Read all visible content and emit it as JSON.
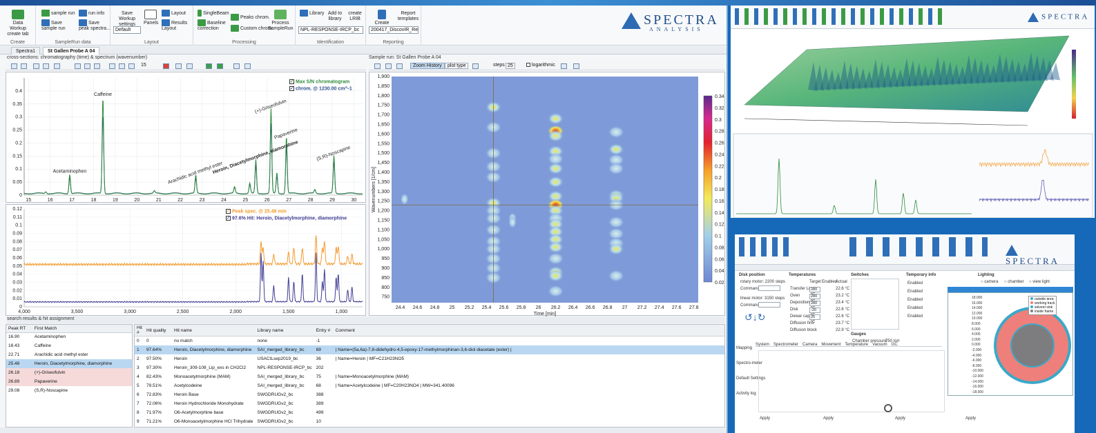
{
  "ribbon": {
    "groups": [
      "Create",
      "SampleRun data",
      "Layout",
      "Processing",
      "Identification",
      "Reporting"
    ],
    "data_workup": "Data Workup create tab",
    "sample_run": "sample run",
    "run_info": "run info",
    "save_sample_run": "Save sample run",
    "save_peak_spectra": "Save peak spectra...",
    "save_workup_settings": "Save Workup settings",
    "workup_default": "Default",
    "panels": "Panels",
    "layout": "Layout",
    "results_layout": "Results Layout",
    "singlebeam": "SingleBeam",
    "baseline_correction": "Baseline correction",
    "peaks_chrom": "Peaks chrom.",
    "custom_chrom": "Custom chrom.",
    "process_samplerun": "Process SampleRun",
    "library": "Library",
    "add_to_library": "Add to library",
    "create_lib": "create LRIB",
    "library_value": "NPL-RESPONSE-IRCP_bc",
    "create_report": "Create Report",
    "report_templates": "Report templates",
    "report_value": "200417_DiscovIR_Repo"
  },
  "logo": {
    "name": "SPECTRA",
    "sub": "ANALYSIS"
  },
  "tabs": [
    "Spectra1",
    "St Gallen Probe A 04"
  ],
  "left_header": "cross-sections: chromatography (time) & spectrum (wavenumber)",
  "right_header": "Sample run: St Gallen Probe A 04",
  "chrom_toolbar": {
    "step": "15"
  },
  "heat_toolbar": {
    "zoom_history": "Zoom History",
    "plot_type": "plot type",
    "steps_label": "steps",
    "steps": "25",
    "logarithmic": "logarithmic"
  },
  "chrom_legend": {
    "s1": "Max S/N chromatogram",
    "s2": "chrom. @ 1230.00 cm^-1"
  },
  "spec_legend": {
    "s1": "Peak spec. @ 25.48 min",
    "s2": "97.6% Hit: Heroin,  Diacetylmorphine, diamorphine"
  },
  "chrom_peaks": [
    {
      "label": "Acetaminophen",
      "x": 16.9,
      "y": 0.075
    },
    {
      "label": "Caffeine",
      "x": 18.43,
      "y": 0.37
    },
    {
      "label": "Arachidic acid methyl ester",
      "x": 22.71,
      "y": 0.07
    },
    {
      "label": "Heroin,  Diacetylmorphine, diamorphine",
      "x": 25.48,
      "y": 0.13
    },
    {
      "label": "(+)-Griseofulvin",
      "x": 26.18,
      "y": 0.325
    },
    {
      "label": "Papaverine",
      "x": 26.89,
      "y": 0.22
    },
    {
      "label": "(S,R)-Noscapine",
      "x": 29.08,
      "y": 0.145
    }
  ],
  "chart_data": [
    {
      "type": "line",
      "title": "",
      "xlabel": "",
      "ylabel": "",
      "xlim": [
        14.8,
        30.4
      ],
      "ylim": [
        0,
        0.45
      ],
      "xticks": [
        "15",
        "16",
        "17",
        "18",
        "19",
        "20",
        "21",
        "22",
        "23",
        "24",
        "25",
        "26",
        "27",
        "28",
        "29",
        "30"
      ],
      "yticks": [
        "0",
        "0.05",
        "0.1",
        "0.15",
        "0.2",
        "0.25",
        "0.3",
        "0.35",
        "0.4"
      ],
      "series": [
        {
          "name": "Max S/N chromatogram",
          "color": "#2f8a3c"
        },
        {
          "name": "chrom. @ 1230.00 cm^-1",
          "color": "#2f4f8f"
        }
      ]
    },
    {
      "type": "line",
      "xlim": [
        4000,
        800
      ],
      "ylim": [
        0,
        0.12
      ],
      "xticks": [
        "4,000",
        "3,500",
        "3,000",
        "2,500",
        "2,000",
        "1,500",
        "1,000"
      ],
      "yticks": [
        "0",
        "0.01",
        "0.02",
        "0.03",
        "0.04",
        "0.05",
        "0.06",
        "0.07",
        "0.08",
        "0.09",
        "0.1",
        "0.11",
        "0.12"
      ],
      "series": [
        {
          "name": "Peak spec. @ 25.48 min",
          "color": "#f39a2c"
        },
        {
          "name": "97.6% Hit: Heroin,  Diacetylmorphine, diamorphine",
          "color": "#3d3b93"
        }
      ]
    },
    {
      "type": "heatmap",
      "xlabel": "Time [min]",
      "ylabel": "Wavenumbers [1/cm]",
      "xlim": [
        24.3,
        27.85
      ],
      "ylim": [
        720,
        1900
      ],
      "xticks": [
        "24.4",
        "24.6",
        "24.8",
        "25",
        "25.2",
        "25.4",
        "25.6",
        "25.8",
        "26",
        "26.2",
        "26.4",
        "26.6",
        "26.8",
        "27",
        "27.2",
        "27.4",
        "27.6",
        "27.8"
      ],
      "yticks": [
        "750",
        "800",
        "850",
        "900",
        "950",
        "1,000",
        "1,050",
        "1,100",
        "1,150",
        "1,200",
        "1,250",
        "1,300",
        "1,350",
        "1,400",
        "1,450",
        "1,500",
        "1,550",
        "1,600",
        "1,650",
        "1,700",
        "1,750",
        "1,800",
        "1,850",
        "1,900"
      ],
      "colorbar": [
        "0.34",
        "0.32",
        "0.3",
        "0.28",
        "0.26",
        "0.24",
        "0.22",
        "0.2",
        "0.18",
        "0.16",
        "0.14",
        "0.12",
        "0.1",
        "0.08",
        "0.06",
        "0.04",
        "0.02"
      ]
    }
  ],
  "results_header": "search results & hit assignment",
  "peaks_table": {
    "headers": [
      "Peak RT",
      "First Match"
    ],
    "rows": [
      [
        "16.90",
        "Acetaminophen"
      ],
      [
        "18.43",
        "Caffeine"
      ],
      [
        "22.71",
        "Arachidic acid methyl ester"
      ],
      [
        "25.48",
        "Heroin,  Diacetylmorphine, diamorphine"
      ],
      [
        "26.18",
        "(+)-Griseofulvin"
      ],
      [
        "26.89",
        "Papaverine"
      ],
      [
        "29.08",
        "(S,R)-Noscapine"
      ]
    ]
  },
  "hits_table": {
    "headers": [
      "Hit #",
      "Hit quality",
      "Hit name",
      "Library name",
      "Entry #",
      "Comment"
    ],
    "rows": [
      [
        "0",
        "0",
        "no match",
        "none",
        "-1",
        ""
      ],
      [
        "1",
        "97.64%",
        "Heroin,  Diacetylmorphine,  diamorphine",
        "SAI_merged_library_bc",
        "69",
        "| Name=(5a,6a)-7,8-didehydro-4,5-epoxy-17-methylmorphinan-3,6-diol diacetate (ester) |"
      ],
      [
        "2",
        "97.50%",
        "Heroin",
        "USACILsep2019_bc",
        "36",
        "| Name=Heroin | MF=C21H23NO5"
      ],
      [
        "3",
        "97.30%",
        "Heroin_309-108_Lip_exs in CH2Cl2",
        "NPL-RESPONSE-IRCP_bc",
        "202",
        ""
      ],
      [
        "4",
        "82.43%",
        "Monoacetylmorphine (MAM)",
        "SAI_merged_library_bc",
        "75",
        "| Name=Monoacetylmorphine (MAM)"
      ],
      [
        "5",
        "79.51%",
        "Acetylcodeine",
        "SAI_merged_library_bc",
        "68",
        "| Name=Acetylcodeine | MF=C20H23NO4 | MW=341.40096"
      ],
      [
        "6",
        "72.83%",
        "Heroin Base",
        "SWGDRUGv2_bc",
        "388",
        ""
      ],
      [
        "7",
        "72.06%",
        "Heroin Hydrochloride Monohydrate",
        "SWGDRUGv2_bc",
        "389",
        ""
      ],
      [
        "8",
        "71.97%",
        "O6-Acetylmorphine base",
        "SWGDRUGv2_bc",
        "499",
        ""
      ],
      [
        "9",
        "71.21%",
        "O6-Monoacetylmorphine HCl Trihydrate",
        "SWGDRUGv2_bc",
        "10",
        ""
      ]
    ]
  },
  "control": {
    "disk_position": "Disk position",
    "rotary_motor": "rotary motor: 2200 steps",
    "linear_motor": "linear motor: 3150 steps",
    "command": "Command",
    "temperatures": "Temperatures",
    "temp_cols": [
      "Target",
      "Enabled",
      "Actual"
    ],
    "temp_rows": [
      [
        "Transfer Line",
        "280 °C",
        "22.6 °C"
      ],
      [
        "Oven",
        "280 °C",
        "23.2 °C"
      ],
      [
        "Deposition tip",
        "280 °C",
        "23.4 °C"
      ],
      [
        "Disk",
        "-20 °C",
        "22.6 °C"
      ],
      [
        "Dewar cap",
        "25 °C",
        "22.6 °C"
      ],
      [
        "Diffusion fins",
        "",
        "23.7 °C"
      ],
      [
        "Diffusion block",
        "",
        "22.9 °C"
      ]
    ],
    "switches": "Switches",
    "temporary_info": "Temporary info",
    "enabled": "Enabled",
    "gauges": "Gauges",
    "chamber_pressure": "Chamber pressure:",
    "pressure_val": "750 torr",
    "lighting": "Lighting",
    "camera": "camera",
    "chamber": "chamber",
    "view_light": "view light",
    "bottom_tabs": [
      "System",
      "Spectrometer",
      "Camera",
      "Movement",
      "Temperature",
      "Vacuum",
      "GC"
    ],
    "side_items": [
      "Mapping",
      "Spectro-meter",
      "Default Settings",
      "Activity log"
    ],
    "apply": "Apply",
    "disk_legend": [
      "outside area",
      "working track",
      "solvent sink",
      "inside frame"
    ],
    "disk_axis": [
      "18.000",
      "16.000",
      "14.000",
      "12.000",
      "10.000",
      "8.000",
      "6.000",
      "4.000",
      "2.000",
      "0.000",
      "-2.000",
      "-4.000",
      "-6.000",
      "-8.000",
      "-10.000",
      "-12.000",
      "-14.000",
      "-16.000",
      "-18.000"
    ]
  }
}
